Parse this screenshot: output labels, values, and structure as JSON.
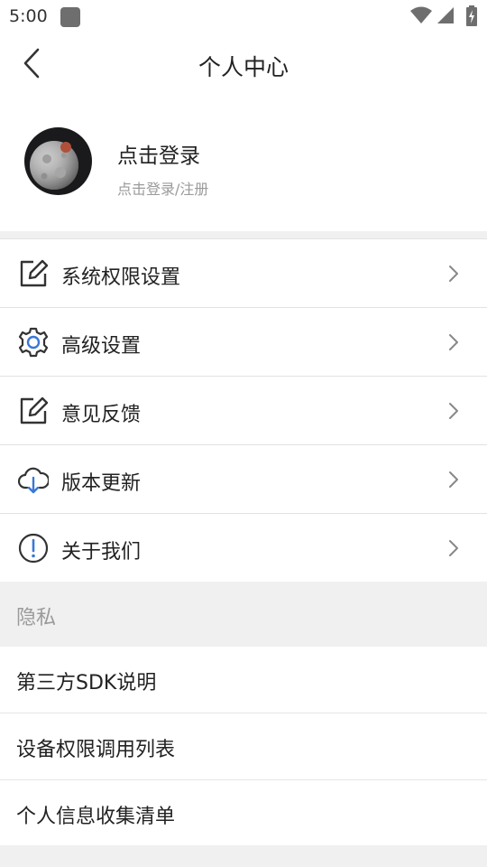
{
  "status_bar": {
    "time": "5:00",
    "icons": [
      "app-notification-icon",
      "wifi-icon",
      "cell-signal-icon",
      "battery-charging-icon"
    ]
  },
  "nav": {
    "title": "个人中心",
    "back_icon": "back-arrow-icon"
  },
  "profile": {
    "name": "点击登录",
    "subtitle": "点击登录/注册",
    "avatar": "moon-avatar"
  },
  "menu": {
    "items": [
      {
        "label": "系统权限设置",
        "icon": "edit-icon"
      },
      {
        "label": "高级设置",
        "icon": "gear-icon"
      },
      {
        "label": "意见反馈",
        "icon": "edit-icon"
      },
      {
        "label": "版本更新",
        "icon": "cloud-download-icon"
      },
      {
        "label": "关于我们",
        "icon": "info-icon"
      }
    ]
  },
  "privacy": {
    "header": "隐私",
    "items": [
      {
        "label": "第三方SDK说明"
      },
      {
        "label": "设备权限调用列表"
      },
      {
        "label": "个人信息收集清单"
      }
    ]
  },
  "colors": {
    "text": "#222222",
    "secondary_text": "#9a9a9a",
    "section_bg": "#f0f0f0",
    "accent_blue": "#3a78d6"
  }
}
